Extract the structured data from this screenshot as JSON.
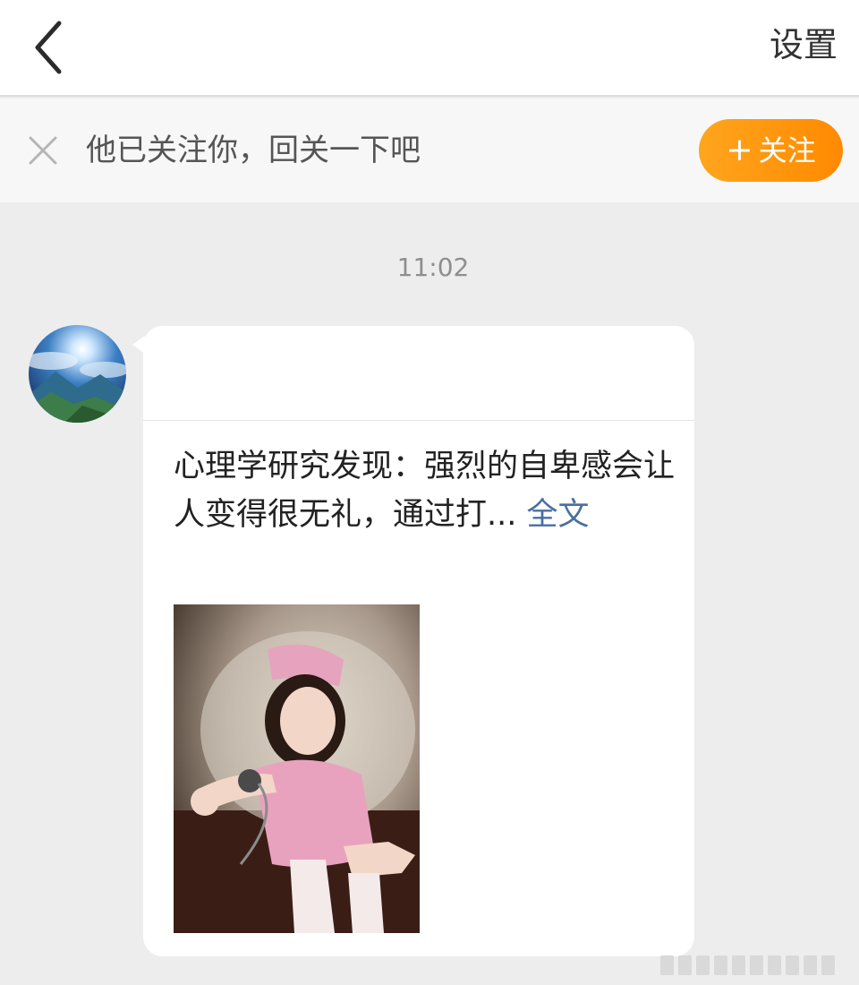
{
  "header": {
    "back_icon": "chevron-left-icon",
    "settings_label": "设置"
  },
  "follow_banner": {
    "close_icon": "close-icon",
    "text": "他已关注你，回关一下吧",
    "follow_button": {
      "plus": "+",
      "label": "关注"
    },
    "accent_color": "#ff9a10"
  },
  "chat": {
    "timestamp": "11:02",
    "message": {
      "text": "心理学研究发现：强烈的自卑感会让人变得很无礼，通过打...",
      "read_more_label": "全文",
      "image_icon": "post-photo"
    }
  }
}
